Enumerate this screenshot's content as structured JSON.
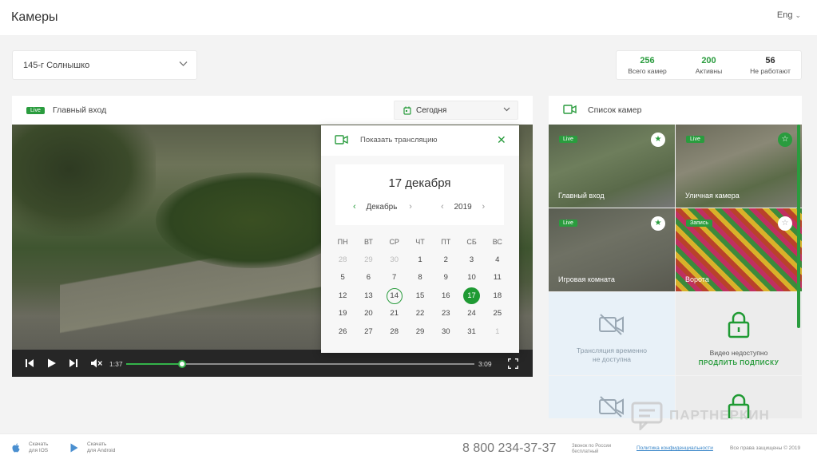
{
  "header": {
    "title": "Камеры",
    "lang": "Eng"
  },
  "object_select": {
    "value": "145-г Солнышко"
  },
  "stats": [
    {
      "value": "256",
      "label": "Всего камер",
      "color": "#2a9c3e"
    },
    {
      "value": "200",
      "label": "Активны",
      "color": "#2a9c3e"
    },
    {
      "value": "56",
      "label": "Не работают",
      "color": "#333333"
    }
  ],
  "player": {
    "badge": "Live",
    "title": "Главный вход",
    "date_select": "Сегодня",
    "current_time": "1:37",
    "total_time": "3:09",
    "progress": 0.16
  },
  "calendar_popup": {
    "title": "Показать трансляцию",
    "selected_date": "17 декабря",
    "month": "Декабрь",
    "year": "2019",
    "weekdays": [
      "ПН",
      "ВТ",
      "СР",
      "ЧТ",
      "ПТ",
      "СБ",
      "ВС"
    ],
    "weeks": [
      [
        "28",
        "29",
        "30",
        "1",
        "2",
        "3",
        "4"
      ],
      [
        "5",
        "6",
        "7",
        "8",
        "9",
        "10",
        "11"
      ],
      [
        "12",
        "13",
        "14",
        "15",
        "16",
        "17",
        "18"
      ],
      [
        "19",
        "20",
        "21",
        "22",
        "23",
        "24",
        "25"
      ],
      [
        "26",
        "27",
        "28",
        "29",
        "30",
        "31",
        "1"
      ]
    ]
  },
  "camera_list": {
    "title": "Список камер",
    "tiles": [
      {
        "badge": "Live",
        "name": "Главный вход"
      },
      {
        "badge": "Live",
        "name": "Уличная камера"
      },
      {
        "badge": "Live",
        "name": "Игровая комната"
      },
      {
        "badge": "Запись",
        "name": "Ворота"
      },
      {
        "message_line1": "Трансляция временно",
        "message_line2": "не доступна"
      },
      {
        "message": "Видео недоступно",
        "link": "ПРОДЛИТЬ ПОДПИСКУ"
      }
    ]
  },
  "footer": {
    "ios_line1": "Скачать",
    "ios_line2": "для IOS",
    "android_line1": "Скачать",
    "android_line2": "для Android",
    "phone": "8 800 234-37-37",
    "phone_note1": "Звонок по России",
    "phone_note2": "бесплатный",
    "privacy": "Политика конфиденциальности",
    "rights": "Все права защищены © 2019"
  },
  "watermark": "ПАРТНЕРКИН",
  "colors": {
    "accent": "#2a9c3e",
    "selected_day": "#1f9a33",
    "link": "#3a86c8"
  },
  "icons": [
    "chevron-down-icon",
    "calendar-icon",
    "video-camera-icon",
    "close-icon",
    "star-icon",
    "video-off-icon",
    "lock-icon",
    "skip-back-icon",
    "play-icon",
    "skip-forward-icon",
    "volume-icon",
    "fullscreen-icon",
    "apple-icon",
    "google-play-icon"
  ]
}
